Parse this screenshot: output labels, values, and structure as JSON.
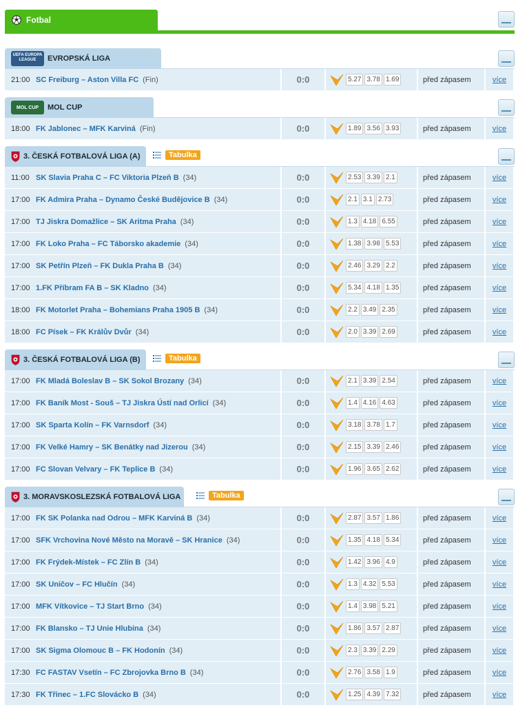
{
  "sport": {
    "label": "Fotbal",
    "icon": "football-icon"
  },
  "common": {
    "status": "před zápasem",
    "more": "více",
    "standings": "Tabulka"
  },
  "leagues": [
    {
      "name": "EVROPSKÁ LIGA",
      "icon": "europa-league-logo",
      "icon_text": "UEFA EUROPA LEAGUE",
      "has_table": false,
      "matches": [
        {
          "time": "21:00",
          "teams": "SC Freiburg – Aston Villa FC",
          "round": "(Fin)",
          "score": "0:0",
          "odds": [
            "5.27",
            "3.78",
            "1.69"
          ]
        }
      ]
    },
    {
      "name": "MOL CUP",
      "icon": "mol-cup-logo",
      "icon_text": "MOL CUP",
      "has_table": false,
      "matches": [
        {
          "time": "18:00",
          "teams": "FK Jablonec – MFK Karviná",
          "round": "(Fin)",
          "score": "0:0",
          "odds": [
            "1.89",
            "3.56",
            "3.93"
          ]
        }
      ]
    },
    {
      "name": "3. ČESKÁ FOTBALOVÁ LIGA (A)",
      "icon": "facr-crest-icon",
      "has_table": true,
      "matches": [
        {
          "time": "11:00",
          "teams": "SK Slavia Praha C – FC Viktoria Plzeň B",
          "round": "(34)",
          "score": "0:0",
          "odds": [
            "2.53",
            "3.39",
            "2.1"
          ]
        },
        {
          "time": "17:00",
          "teams": "FK Admira Praha – Dynamo České Budějovice B",
          "round": "(34)",
          "score": "0:0",
          "odds": [
            "2.1",
            "3.1",
            "2.73"
          ]
        },
        {
          "time": "17:00",
          "teams": "TJ Jiskra Domažlice – SK Aritma Praha",
          "round": "(34)",
          "score": "0:0",
          "odds": [
            "1.3",
            "4.18",
            "6.55"
          ]
        },
        {
          "time": "17:00",
          "teams": "FK Loko Praha – FC Táborsko akademie",
          "round": "(34)",
          "score": "0:0",
          "odds": [
            "1.38",
            "3.98",
            "5.53"
          ]
        },
        {
          "time": "17:00",
          "teams": "SK Petřín Plzeň – FK Dukla Praha B",
          "round": "(34)",
          "score": "0:0",
          "odds": [
            "2.46",
            "3.29",
            "2.2"
          ]
        },
        {
          "time": "17:00",
          "teams": "1.FK Příbram FA B – SK Kladno",
          "round": "(34)",
          "score": "0:0",
          "odds": [
            "5.34",
            "4.18",
            "1.35"
          ]
        },
        {
          "time": "18:00",
          "teams": "FK Motorlet Praha – Bohemians Praha 1905 B",
          "round": "(34)",
          "score": "0:0",
          "odds": [
            "2.2",
            "3.49",
            "2.35"
          ]
        },
        {
          "time": "18:00",
          "teams": "FC Písek – FK Králův Dvůr",
          "round": "(34)",
          "score": "0:0",
          "odds": [
            "2.0",
            "3.39",
            "2.69"
          ]
        }
      ]
    },
    {
      "name": "3. ČESKÁ FOTBALOVÁ LIGA (B)",
      "icon": "facr-crest-icon",
      "has_table": true,
      "matches": [
        {
          "time": "17:00",
          "teams": "FK Mladá Boleslav B – SK Sokol Brozany",
          "round": "(34)",
          "score": "0:0",
          "odds": [
            "2.1",
            "3.39",
            "2.54"
          ]
        },
        {
          "time": "17:00",
          "teams": "FK Baník Most - Souš – TJ Jiskra Ústí nad Orlicí",
          "round": "(34)",
          "score": "0:0",
          "odds": [
            "1.4",
            "4.16",
            "4.63"
          ]
        },
        {
          "time": "17:00",
          "teams": "SK Sparta Kolín – FK Varnsdorf",
          "round": "(34)",
          "score": "0:0",
          "odds": [
            "3.18",
            "3.78",
            "1.7"
          ]
        },
        {
          "time": "17:00",
          "teams": "FK Velké Hamry – SK Benátky nad Jizerou",
          "round": "(34)",
          "score": "0:0",
          "odds": [
            "2.15",
            "3.39",
            "2.46"
          ]
        },
        {
          "time": "17:00",
          "teams": "FC Slovan Velvary – FK Teplice B",
          "round": "(34)",
          "score": "0:0",
          "odds": [
            "1.96",
            "3.65",
            "2.62"
          ]
        }
      ]
    },
    {
      "name": "3. MORAVSKOSLEZSKÁ FOTBALOVÁ LIGA",
      "icon": "facr-crest-icon",
      "has_table": true,
      "matches": [
        {
          "time": "17:00",
          "teams": "FK SK Polanka nad Odrou – MFK Karviná B",
          "round": "(34)",
          "score": "0:0",
          "odds": [
            "2.87",
            "3.57",
            "1.86"
          ]
        },
        {
          "time": "17:00",
          "teams": "SFK Vrchovina Nové Město na Moravě – SK Hranice",
          "round": "(34)",
          "score": "0:0",
          "odds": [
            "1.35",
            "4.18",
            "5.34"
          ]
        },
        {
          "time": "17:00",
          "teams": "FK Frýdek-Místek – FC Zlín B",
          "round": "(34)",
          "score": "0:0",
          "odds": [
            "1.42",
            "3.96",
            "4.9"
          ]
        },
        {
          "time": "17:00",
          "teams": "SK Uničov – FC Hlučín",
          "round": "(34)",
          "score": "0:0",
          "odds": [
            "1.3",
            "4.32",
            "5.53"
          ]
        },
        {
          "time": "17:00",
          "teams": "MFK Vítkovice – TJ Start Brno",
          "round": "(34)",
          "score": "0:0",
          "odds": [
            "1.4",
            "3.98",
            "5.21"
          ]
        },
        {
          "time": "17:00",
          "teams": "FK Blansko – TJ Unie Hlubina",
          "round": "(34)",
          "score": "0:0",
          "odds": [
            "1.86",
            "3.57",
            "2.87"
          ]
        },
        {
          "time": "17:00",
          "teams": "SK Sigma Olomouc B – FK Hodonín",
          "round": "(34)",
          "score": "0:0",
          "odds": [
            "2.3",
            "3.39",
            "2.29"
          ]
        },
        {
          "time": "17:30",
          "teams": "FC FASTAV Vsetín – FC Zbrojovka Brno B",
          "round": "(34)",
          "score": "0:0",
          "odds": [
            "2.76",
            "3.58",
            "1.9"
          ]
        },
        {
          "time": "17:30",
          "teams": "FK Třinec – 1.FC Slovácko B",
          "round": "(34)",
          "score": "0:0",
          "odds": [
            "1.25",
            "4.39",
            "7.32"
          ]
        }
      ]
    }
  ]
}
